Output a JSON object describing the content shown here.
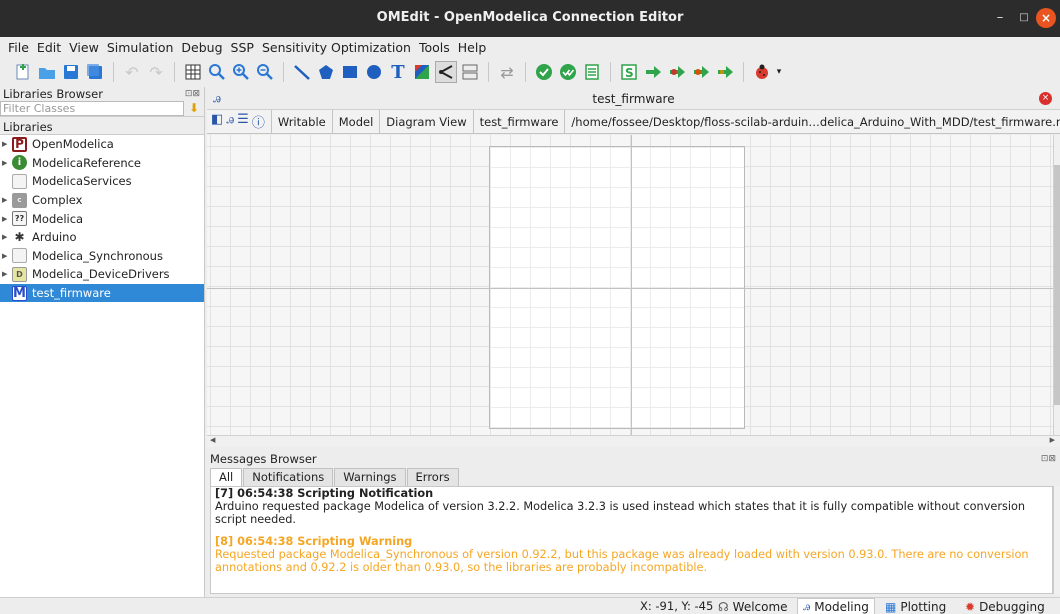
{
  "window": {
    "title": "OMEdit - OpenModelica Connection Editor",
    "minimize_glyph": "–",
    "maximize_glyph": "□",
    "close_glyph": "×"
  },
  "menu": [
    "File",
    "Edit",
    "View",
    "Simulation",
    "Debug",
    "SSP",
    "Sensitivity Optimization",
    "Tools",
    "Help"
  ],
  "toolbar_icons": [
    "new-model-icon",
    "open-folder-icon",
    "save-icon",
    "save-all-icon",
    "undo-icon",
    "redo-icon",
    "grid-icon",
    "zoom-fit-icon",
    "zoom-in-icon",
    "zoom-out-icon",
    "line-tool-icon",
    "polygon-tool-icon",
    "rectangle-tool-icon",
    "ellipse-tool-icon",
    "text-tool-icon",
    "bitmap-tool-icon",
    "connect-mode-icon",
    "transition-mode-icon",
    "model-swap-icon",
    "check-model-icon",
    "check-all-icon",
    "instantiate-icon",
    "simulation-setup-icon",
    "simulate-icon",
    "simulate-debugger-icon",
    "simulate-animation-icon",
    "debug-icon"
  ],
  "libraries_browser": {
    "title": "Libraries Browser",
    "filter_placeholder": "Filter Classes",
    "section_label": "Libraries",
    "items": [
      {
        "label": "OpenModelica",
        "icon": "openmodelica-icon",
        "glyph": "P",
        "has_arrow": true
      },
      {
        "label": "ModelicaReference",
        "icon": "info-icon",
        "glyph": "i",
        "has_arrow": true
      },
      {
        "label": "ModelicaServices",
        "icon": "package-icon",
        "glyph": "",
        "has_arrow": false
      },
      {
        "label": "Complex",
        "icon": "complex-icon",
        "glyph": "c",
        "has_arrow": true
      },
      {
        "label": "Modelica",
        "icon": "modelica-icon",
        "glyph": "??",
        "has_arrow": true
      },
      {
        "label": "Arduino",
        "icon": "arduino-chip-icon",
        "glyph": "✱",
        "has_arrow": true
      },
      {
        "label": "Modelica_Synchronous",
        "icon": "package-icon",
        "glyph": "",
        "has_arrow": true
      },
      {
        "label": "Modelica_DeviceDrivers",
        "icon": "device-drivers-icon",
        "glyph": "D",
        "has_arrow": true
      },
      {
        "label": "test_firmware",
        "icon": "model-icon",
        "glyph": "M",
        "has_arrow": false,
        "selected": true
      }
    ]
  },
  "model_tab": {
    "title": "test_firmware",
    "close_glyph": "×",
    "info": {
      "access": "Writable",
      "type": "Model",
      "view": "Diagram View",
      "name": "test_firmware",
      "path": "/home/fossee/Desktop/floss-scilab-arduin…delica_Arduino_With_MDD/test_firmware.mo"
    }
  },
  "messages_browser": {
    "title": "Messages Browser",
    "tabs": [
      "All",
      "Notifications",
      "Warnings",
      "Errors"
    ],
    "active_tab": "All",
    "messages": [
      {
        "header": "[7] 06:54:38 Scripting Notification",
        "text": "Arduino requested package Modelica of version 3.2.2. Modelica 3.2.3 is used instead which states that it is fully compatible without conversion script needed.",
        "kind": "notification"
      },
      {
        "header": "[8] 06:54:38 Scripting Warning",
        "text": "Requested package Modelica_Synchronous of version 0.92.2, but this package was already loaded with version 0.93.0. There are no conversion annotations and 0.92.2 is older than 0.93.0, so the libraries are probably incompatible.",
        "kind": "warning"
      }
    ]
  },
  "statusbar": {
    "coords": "X: -91, Y: -45",
    "perspectives": [
      {
        "label": "Welcome",
        "icon": "welcome-icon",
        "active": false
      },
      {
        "label": "Modeling",
        "icon": "modeling-icon",
        "active": true
      },
      {
        "label": "Plotting",
        "icon": "plotting-icon",
        "active": false
      },
      {
        "label": "Debugging",
        "icon": "debugging-icon",
        "active": false
      }
    ]
  },
  "colors": {
    "titlebar_bg": "#2c2c2c",
    "window_close": "#e95420",
    "selection": "#3089d6",
    "warning_text": "#f5a623"
  }
}
